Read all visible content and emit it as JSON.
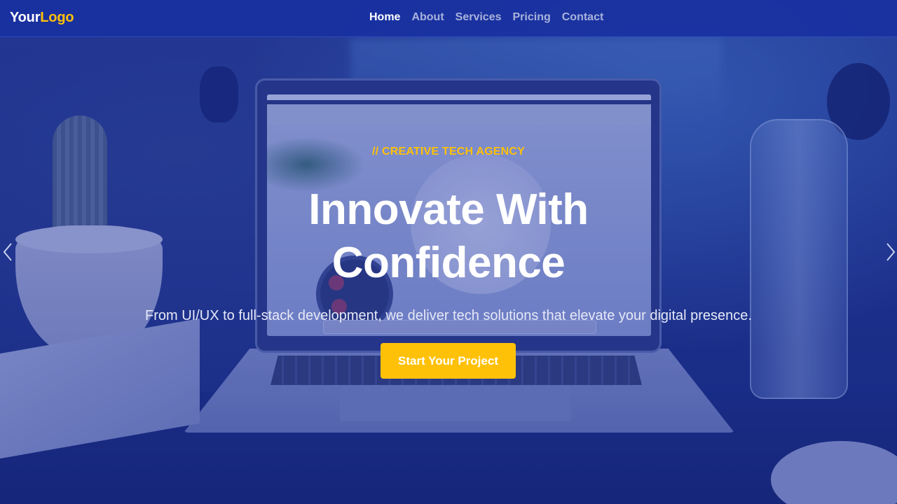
{
  "navbar": {
    "logo_primary": "Your",
    "logo_accent": "Logo",
    "links": [
      "Home",
      "About",
      "Services",
      "Pricing",
      "Contact"
    ],
    "active_link": "Home"
  },
  "hero": {
    "eyebrow": "// CREATIVE TECH AGENCY",
    "headline_line1": "Innovate With",
    "headline_line2": "Confidence",
    "subtitle": "From UI/UX to full-stack development, we deliver tech solutions that elevate your digital presence.",
    "cta_label": "Start Your Project"
  },
  "carousel": {
    "prev_icon": "chevron-left-icon",
    "next_icon": "chevron-right-icon"
  },
  "colors": {
    "accent": "#ffc107",
    "navbar": "#1830a0",
    "overlay": "#1a2e96"
  }
}
